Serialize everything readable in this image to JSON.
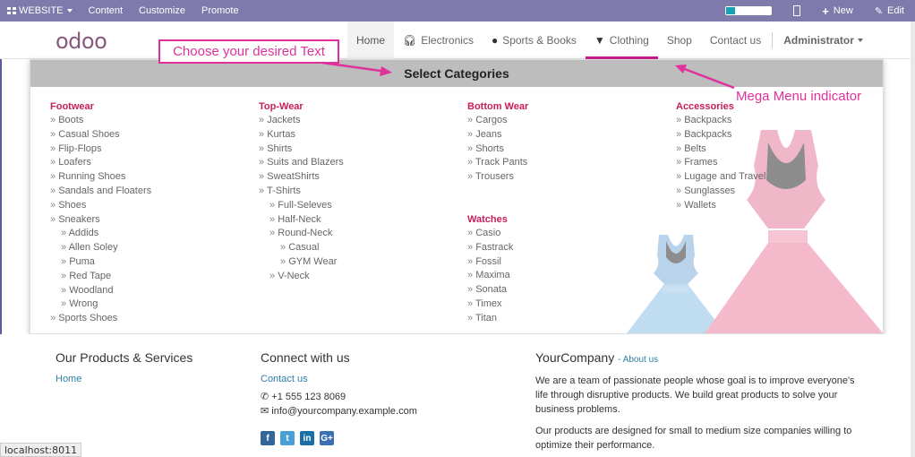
{
  "adminbar": {
    "website_label": "WEBSITE",
    "menu": [
      "Content",
      "Customize",
      "Promote"
    ],
    "new_label": "New",
    "edit_label": "Edit"
  },
  "navbar": {
    "logo_main": "odoo",
    "links": {
      "home": "Home",
      "electronics": "Electronics",
      "sports": "Sports & Books",
      "clothing": "Clothing",
      "shop": "Shop",
      "contact": "Contact us",
      "admin": "Administrator"
    }
  },
  "annotations": {
    "choose_text": "Choose your desired Text",
    "mega_indicator": "Mega Menu indicator"
  },
  "mega": {
    "title": "Select Categories",
    "footwear": {
      "heading": "Footwear",
      "items": [
        "Boots",
        "Casual Shoes",
        "Flip-Flops",
        "Loafers",
        "Running Shoes",
        "Sandals and Floaters",
        "Shoes",
        "Sneakers"
      ],
      "sneakers_sub": [
        "Addids",
        "Allen Soley",
        "Puma",
        "Red Tape",
        "Woodland",
        "Wrong"
      ],
      "last": "Sports Shoes"
    },
    "topwear": {
      "heading": "Top-Wear",
      "items": [
        "Jackets",
        "Kurtas",
        "Shirts",
        "Suits and Blazers",
        "SweatShirts",
        "T-Shirts"
      ],
      "tshirt_sub": [
        "Full-Seleves",
        "Half-Neck",
        "Round-Neck"
      ],
      "roundneck_sub": [
        "Casual",
        "GYM Wear"
      ],
      "vneck": "V-Neck"
    },
    "bottomwear": {
      "heading": "Bottom Wear",
      "items": [
        "Cargos",
        "Jeans",
        "Shorts",
        "Track Pants",
        "Trousers"
      ]
    },
    "watches": {
      "heading": "Watches",
      "items": [
        "Casio",
        "Fastrack",
        "Fossil",
        "Maxima",
        "Sonata",
        "Timex",
        "Titan"
      ]
    },
    "accessories": {
      "heading": "Accessories",
      "items": [
        "Backpacks",
        "Backpacks",
        "Belts",
        "Frames",
        "Lugage and Travel",
        "Sunglasses",
        "Wallets"
      ]
    }
  },
  "footer": {
    "products_title": "Our Products & Services",
    "products_link": "Home",
    "connect_title": "Connect with us",
    "contact_link": "Contact us",
    "phone": "+1 555 123 8069",
    "email": "info@yourcompany.example.com",
    "company_title": "YourCompany",
    "about_link": "- About us",
    "para1": "We are a team of passionate people whose goal is to improve everyone's life through disruptive products. We build great products to solve your business problems.",
    "para2": "Our products are designed for small to medium size companies willing to optimize their performance."
  },
  "status_url": "localhost:8011",
  "colors": {
    "adminbar": "#7e7aab",
    "accent": "#c71e8e",
    "annotation": "#e0319b",
    "heading": "#c71e5c"
  }
}
